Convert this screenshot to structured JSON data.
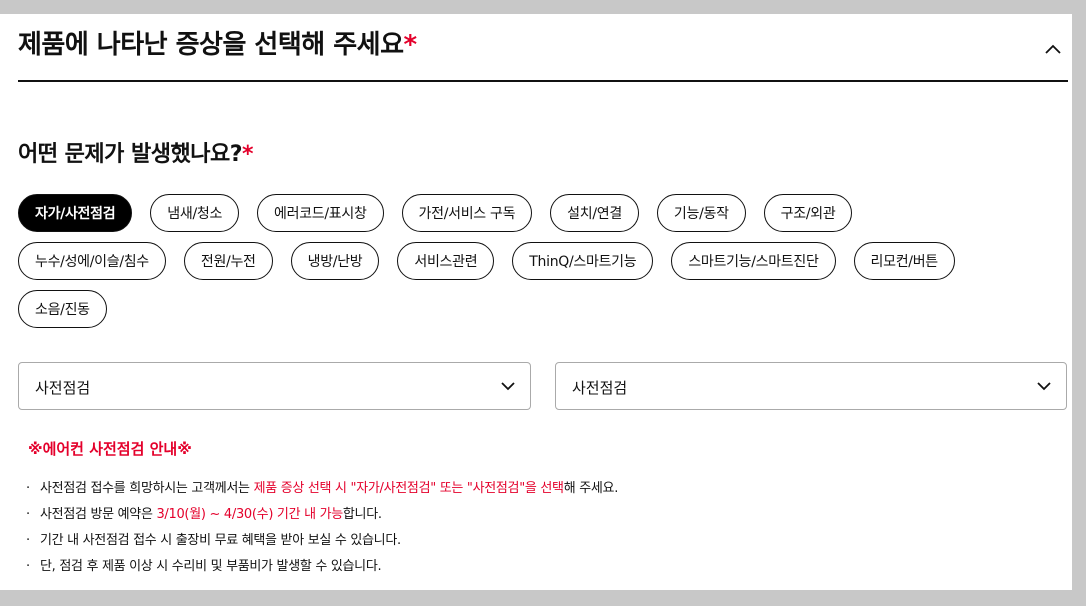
{
  "header": {
    "title": "제품에 나타난 증상을 선택해 주세요",
    "required_mark": "*"
  },
  "question": {
    "label": "어떤 문제가 발생했나요?",
    "required_mark": "*"
  },
  "categories": [
    {
      "label": "자가/사전점검",
      "selected": true
    },
    {
      "label": "냄새/청소",
      "selected": false
    },
    {
      "label": "에러코드/표시창",
      "selected": false
    },
    {
      "label": "가전/서비스 구독",
      "selected": false
    },
    {
      "label": "설치/연결",
      "selected": false
    },
    {
      "label": "기능/동작",
      "selected": false
    },
    {
      "label": "구조/외관",
      "selected": false
    },
    {
      "label": "누수/성에/이슬/침수",
      "selected": false
    },
    {
      "label": "전원/누전",
      "selected": false
    },
    {
      "label": "냉방/난방",
      "selected": false
    },
    {
      "label": "서비스관련",
      "selected": false
    },
    {
      "label": "ThinQ/스마트기능",
      "selected": false
    },
    {
      "label": "스마트기능/스마트진단",
      "selected": false
    },
    {
      "label": "리모컨/버튼",
      "selected": false
    },
    {
      "label": "소음/진동",
      "selected": false
    }
  ],
  "selects": [
    {
      "value": "사전점검"
    },
    {
      "value": "사전점검"
    }
  ],
  "notice": {
    "title": "※에어컨 사전점검 안내※",
    "items": [
      {
        "bullet": "·",
        "a": "사전점검 접수를 희망하시는 고객께서는 ",
        "b": "제품 증상 선택 시 \"자가/사전점검\" 또는 \"사전점검\"을 선택",
        "c": "해 주세요."
      },
      {
        "bullet": "·",
        "a": "사전점검 방문 예약은 ",
        "b": "3/10(월) ~ 4/30(수) 기간 내 가능",
        "c": "합니다."
      },
      {
        "bullet": "·",
        "a": "기간 내 사전점검 접수 시 출장비 무료 혜택을 받아 보실 수 있습니다.",
        "b": "",
        "c": ""
      },
      {
        "bullet": "·",
        "a": "단, 점검 후 제품 이상 시 수리비 및 부품비가 발생할 수 있습니다.",
        "b": "",
        "c": ""
      }
    ]
  },
  "colors": {
    "accent": "#e4002b",
    "selected_chip": "#000000"
  }
}
